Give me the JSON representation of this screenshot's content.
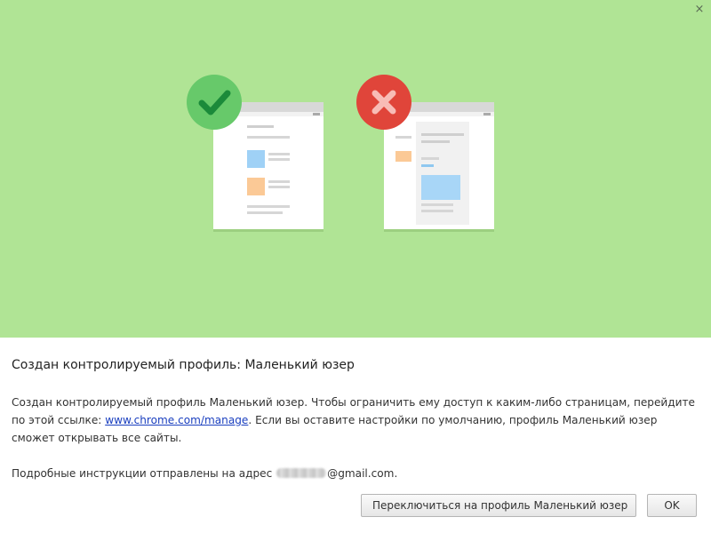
{
  "dialog": {
    "close_label": "×",
    "title": "Создан контролируемый профиль: Маленький юзер",
    "message": {
      "part1": "Создан контролируемый профиль Маленький юзер. Чтобы ограничить ему доступ к каким-либо страницам, перейдите по этой ссылке: ",
      "link": "www.chrome.com/manage",
      "part2": ". Если вы оставите настройки по умолчанию, профиль Маленький юзер сможет открывать все сайты."
    },
    "email_line": {
      "prefix": "Подробные инструкции отправлены на адрес ",
      "suffix": "@gmail.com."
    },
    "buttons": {
      "switch_label": "Переключиться на профиль Маленький юзер",
      "ok_label": "OK"
    }
  },
  "illustrations": {
    "allowed_badge_icon": "checkmark-icon",
    "blocked_badge_icon": "cross-icon"
  },
  "colors": {
    "banner_bg": "#b0e495",
    "badge_green": "#67c96a",
    "badge_red": "#e0453a",
    "link": "#1a3fbf"
  }
}
